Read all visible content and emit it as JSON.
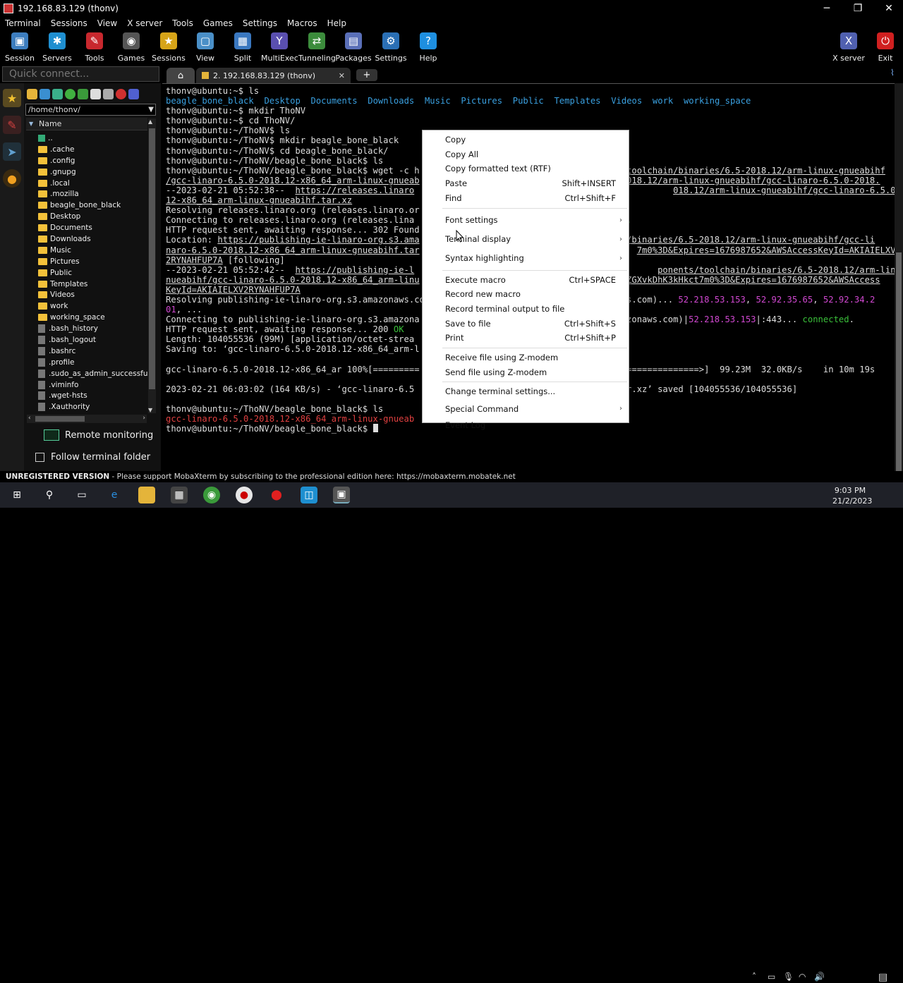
{
  "window": {
    "title": "192.168.83.129 (thonv)",
    "minimize": "─",
    "maximize": "❐",
    "close": "✕"
  },
  "menubar": [
    "Terminal",
    "Sessions",
    "View",
    "X server",
    "Tools",
    "Games",
    "Settings",
    "Macros",
    "Help"
  ],
  "toolbar": {
    "left": [
      {
        "label": "Session",
        "icon": "session-icon",
        "color": "#3d7ebf",
        "glyph": "▣"
      },
      {
        "label": "Servers",
        "icon": "servers-icon",
        "color": "#1f8fd0",
        "glyph": "✱"
      },
      {
        "label": "Tools",
        "icon": "tools-icon",
        "color": "#c8282e",
        "glyph": "✎"
      },
      {
        "label": "Games",
        "icon": "games-icon",
        "color": "#555555",
        "glyph": "◉"
      },
      {
        "label": "Sessions",
        "icon": "star-icon",
        "color": "#d6a418",
        "glyph": "★"
      },
      {
        "label": "View",
        "icon": "view-icon",
        "color": "#4a8fc7",
        "glyph": "▢"
      },
      {
        "label": "Split",
        "icon": "split-icon",
        "color": "#3a78c0",
        "glyph": "▦"
      },
      {
        "label": "MultiExec",
        "icon": "multiexec-icon",
        "color": "#5a4fb0",
        "glyph": "Y"
      },
      {
        "label": "Tunneling",
        "icon": "tunneling-icon",
        "color": "#3c8c3c",
        "glyph": "⇄"
      },
      {
        "label": "Packages",
        "icon": "packages-icon",
        "color": "#5a6fb8",
        "glyph": "▤"
      },
      {
        "label": "Settings",
        "icon": "settings-icon",
        "color": "#2a6fb5",
        "glyph": "⚙"
      },
      {
        "label": "Help",
        "icon": "help-icon",
        "color": "#1e8fe0",
        "glyph": "?"
      }
    ],
    "right": [
      {
        "label": "X server",
        "icon": "xserver-icon",
        "color": "#5060b0",
        "glyph": "X"
      },
      {
        "label": "Exit",
        "icon": "exit-icon",
        "color": "#d02020",
        "glyph": "⏻"
      }
    ]
  },
  "quick_connect": {
    "placeholder": "Quick connect..."
  },
  "sidebar": {
    "path": "/home/thonv/",
    "column": "Name",
    "files": [
      {
        "name": "..",
        "type": "up"
      },
      {
        "name": ".cache",
        "type": "folder"
      },
      {
        "name": ".config",
        "type": "folder"
      },
      {
        "name": ".gnupg",
        "type": "folder"
      },
      {
        "name": ".local",
        "type": "folder"
      },
      {
        "name": ".mozilla",
        "type": "folder"
      },
      {
        "name": "beagle_bone_black",
        "type": "folder"
      },
      {
        "name": "Desktop",
        "type": "folder"
      },
      {
        "name": "Documents",
        "type": "folder"
      },
      {
        "name": "Downloads",
        "type": "folder"
      },
      {
        "name": "Music",
        "type": "folder"
      },
      {
        "name": "Pictures",
        "type": "folder"
      },
      {
        "name": "Public",
        "type": "folder"
      },
      {
        "name": "Templates",
        "type": "folder"
      },
      {
        "name": "Videos",
        "type": "folder"
      },
      {
        "name": "work",
        "type": "folder"
      },
      {
        "name": "working_space",
        "type": "folder"
      },
      {
        "name": ".bash_history",
        "type": "file"
      },
      {
        "name": ".bash_logout",
        "type": "file"
      },
      {
        "name": ".bashrc",
        "type": "file"
      },
      {
        "name": ".profile",
        "type": "file"
      },
      {
        "name": ".sudo_as_admin_successful",
        "type": "file"
      },
      {
        "name": ".viminfo",
        "type": "file"
      },
      {
        "name": ".wget-hsts",
        "type": "file"
      },
      {
        "name": ".Xauthority",
        "type": "file"
      }
    ],
    "remote_monitoring": "Remote monitoring",
    "follow_terminal_folder": "Follow terminal folder"
  },
  "tabs": {
    "session_label": "2. 192.168.83.129 (thonv)",
    "close": "✕",
    "new": "+"
  },
  "terminal": {
    "lines": [
      [
        {
          "t": "thonv@ubuntu:~$ ls"
        }
      ],
      [
        {
          "t": "beagle_bone_black",
          "c": "blue"
        },
        {
          "t": "  "
        },
        {
          "t": "Desktop",
          "c": "blue"
        },
        {
          "t": "  "
        },
        {
          "t": "Documents",
          "c": "blue"
        },
        {
          "t": "  "
        },
        {
          "t": "Downloads",
          "c": "blue"
        },
        {
          "t": "  "
        },
        {
          "t": "Music",
          "c": "blue"
        },
        {
          "t": "  "
        },
        {
          "t": "Pictures",
          "c": "blue"
        },
        {
          "t": "  "
        },
        {
          "t": "Public",
          "c": "blue"
        },
        {
          "t": "  "
        },
        {
          "t": "Templates",
          "c": "blue"
        },
        {
          "t": "  "
        },
        {
          "t": "Videos",
          "c": "blue"
        },
        {
          "t": "  "
        },
        {
          "t": "work",
          "c": "blue"
        },
        {
          "t": "  "
        },
        {
          "t": "working_space",
          "c": "blue"
        }
      ],
      [
        {
          "t": "thonv@ubuntu:~$ mkdir ThoNV"
        }
      ],
      [
        {
          "t": "thonv@ubuntu:~$ cd ThoNV/"
        }
      ],
      [
        {
          "t": "thonv@ubuntu:~/ThoNV$ ls"
        }
      ],
      [
        {
          "t": "thonv@ubuntu:~/ThoNV$ mkdir beagle_bone_black"
        }
      ],
      [
        {
          "t": "thonv@ubuntu:~/ThoNV$ cd beagle_bone_black/"
        }
      ],
      [
        {
          "t": "thonv@ubuntu:~/ThoNV/beagle_bone_black$ ls"
        }
      ],
      [
        {
          "t": "thonv@ubuntu:~/ThoNV/beagle_bone_black$ wget -c h"
        },
        {
          "t": "                                        "
        },
        {
          "t": "toolchain/binaries/6.5-2018.12/arm-linux-gnueabihf",
          "c": "u"
        }
      ],
      [
        {
          "t": "/gcc-linaro-6.5.0-2018.12-x86_64_arm-linux-gnueab",
          "c": "u"
        },
        {
          "t": "                                        "
        },
        {
          "t": "018.12/arm-linux-gnueabihf/gcc-linaro-6.5.0-2018.",
          "c": "u"
        }
      ],
      [
        {
          "t": "--2023-02-21 05:52:38--  "
        },
        {
          "t": "https://releases.linaro",
          "c": "u"
        },
        {
          "t": "                                                  "
        },
        {
          "t": "018.12/arm-linux-gnueabihf/gcc-linaro-6.5.0-2018.",
          "c": "u"
        }
      ],
      [
        {
          "t": "12-x86_64_arm-linux-gnueabihf.tar.xz",
          "c": "u"
        }
      ],
      [
        {
          "t": "Resolving releases.linaro.org (releases.linaro.or"
        }
      ],
      [
        {
          "t": "Connecting to releases.linaro.org (releases.lina"
        },
        {
          "t": "                                         "
        },
        {
          "t": ".",
          "c": "grn"
        }
      ],
      [
        {
          "t": "HTTP request sent, awaiting response... 302 Found"
        }
      ],
      [
        {
          "t": "Location: "
        },
        {
          "t": "https://publishing-ie-linaro-org.s3.ama",
          "c": "u"
        },
        {
          "t": "                                      "
        },
        {
          "t": "in/binaries/6.5-2018.12/arm-linux-gnueabihf/gcc-li",
          "c": "u"
        }
      ],
      [
        {
          "t": "naro-6.5.0-2018.12-x86_64_arm-linux-gnueabihf.tar",
          "c": "u"
        },
        {
          "t": "                                          "
        },
        {
          "t": "7m0%3D&Expires=1676987652&AWSAccessKeyId=AKIAIELXV",
          "c": "u"
        }
      ],
      [
        {
          "t": "2RYNAHFUP7A",
          "c": "u"
        },
        {
          "t": " [following]"
        }
      ],
      [
        {
          "t": "--2023-02-21 05:52:42--  "
        },
        {
          "t": "https://publishing-ie-l",
          "c": "u"
        },
        {
          "t": "                                               "
        },
        {
          "t": "ponents/toolchain/binaries/6.5-2018.12/arm-linux-g",
          "c": "u"
        }
      ],
      [
        {
          "t": "nueabihf/gcc-linaro-6.5.0-2018.12-x86_64_arm-linu",
          "c": "u"
        },
        {
          "t": "                                        "
        },
        {
          "t": "ZGXvkDhK3kHkct7m0%3D&Expires=1676987652&AWSAccess",
          "c": "u"
        }
      ],
      [
        {
          "t": "KeyId=AKIAIELXV2RYNAHFUP7A",
          "c": "u"
        }
      ],
      [
        {
          "t": "Resolving publishing-ie-linaro-org.s3.amazonaws.co"
        },
        {
          "t": "                                      "
        },
        {
          "t": "ws.com)... "
        },
        {
          "t": "52.218.53.153",
          "c": "mag"
        },
        {
          "t": ", "
        },
        {
          "t": "52.92.35.65",
          "c": "mag"
        },
        {
          "t": ", "
        },
        {
          "t": "52.92.34.2",
          "c": "mag"
        }
      ],
      [
        {
          "t": "01",
          "c": "mag"
        },
        {
          "t": ", ..."
        }
      ],
      [
        {
          "t": "Connecting to publishing-ie-linaro-org.s3.amazona"
        },
        {
          "t": "                                        "
        },
        {
          "t": "zonaws.com)|"
        },
        {
          "t": "52.218.53.153",
          "c": "mag"
        },
        {
          "t": "|:443... "
        },
        {
          "t": "connected",
          "c": "grn"
        },
        {
          "t": "."
        }
      ],
      [
        {
          "t": "HTTP request sent, awaiting response... 200 "
        },
        {
          "t": "OK",
          "c": "grn"
        }
      ],
      [
        {
          "t": "Length: 104055536 (99M) [application/octet-strea"
        }
      ],
      [
        {
          "t": "Saving to: ‘gcc-linaro-6.5.0-2018.12-x86_64_arm-l"
        }
      ],
      [
        {
          "t": ""
        }
      ],
      [
        {
          "t": "gcc-linaro-6.5.0-2018.12-x86_64_ar 100%[========="
        },
        {
          "t": "                                        "
        },
        {
          "t": "==============>]  99.23M  32.0KB/s    in 10m 19s"
        }
      ],
      [
        {
          "t": ""
        }
      ],
      [
        {
          "t": "2023-02-21 06:03:02 (164 KB/s) - ‘gcc-linaro-6.5"
        },
        {
          "t": "                                        "
        },
        {
          "t": "ar.xz’ saved [104055536/104055536]"
        }
      ],
      [
        {
          "t": ""
        }
      ],
      [
        {
          "t": "thonv@ubuntu:~/ThoNV/beagle_bone_black$ ls"
        }
      ],
      [
        {
          "t": "gcc-linaro-6.5.0-2018.12-x86_64_arm-linux-gnueab",
          "c": "red"
        }
      ],
      [
        {
          "t": "thonv@ubuntu:~/ThoNV/beagle_bone_black$ "
        },
        {
          "t": "",
          "cursor": true
        }
      ]
    ]
  },
  "context_menu": {
    "groups": [
      [
        {
          "label": "Copy"
        },
        {
          "label": "Copy All"
        },
        {
          "label": "Copy formatted text (RTF)"
        },
        {
          "label": "Paste",
          "shortcut": "Shift+INSERT"
        },
        {
          "label": "Find",
          "shortcut": "Ctrl+Shift+F"
        }
      ],
      [
        {
          "label": "Font settings",
          "submenu": true
        },
        {
          "label": "Terminal display",
          "submenu": true
        },
        {
          "label": "Syntax highlighting",
          "submenu": true
        }
      ],
      [
        {
          "label": "Execute macro",
          "shortcut": "Ctrl+SPACE"
        },
        {
          "label": "Record new macro"
        },
        {
          "label": "Record terminal output to file"
        },
        {
          "label": "Save to file",
          "shortcut": "Ctrl+Shift+S"
        },
        {
          "label": "Print",
          "shortcut": "Ctrl+Shift+P"
        }
      ],
      [
        {
          "label": "Receive file using Z-modem"
        },
        {
          "label": "Send file using Z-modem"
        }
      ],
      [
        {
          "label": "Change terminal settings..."
        },
        {
          "label": "Special Command",
          "submenu": true
        },
        {
          "label": "Event Log"
        }
      ]
    ]
  },
  "statusbar": {
    "unregistered": "UNREGISTERED VERSION",
    "message": "  -  Please support MobaXterm by subscribing to the professional edition here:  ",
    "link": "https://mobaxterm.mobatek.net"
  },
  "taskbar": {
    "time": "9:03 PM",
    "date": "21/2/2023"
  }
}
